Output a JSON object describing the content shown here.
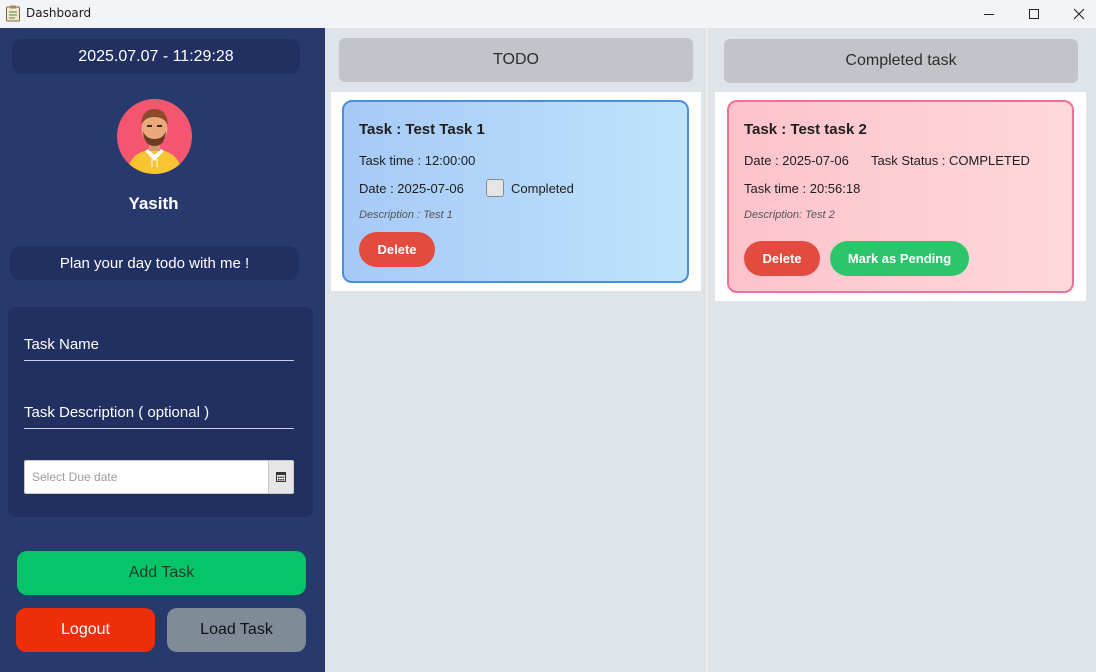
{
  "window": {
    "title": "Dashboard"
  },
  "sidebar": {
    "datetime": "2025.07.07 - 11:29:28",
    "user_name": "Yasith",
    "motto": "Plan your day todo with me !",
    "form": {
      "task_name_placeholder": "Task Name",
      "task_description_placeholder": "Task Description ( optional )",
      "due_date_placeholder": "Select Due date"
    },
    "buttons": {
      "add_task": "Add Task",
      "logout": "Logout",
      "load_task": "Load Task"
    }
  },
  "todo_column": {
    "header": "TODO",
    "tasks": [
      {
        "title": "Task : Test Task 1",
        "time": "Task time : 12:00:00",
        "date": "Date : 2025-07-06",
        "completed_label": "Completed",
        "completed": false,
        "description": "Description : Test 1",
        "delete_label": "Delete"
      }
    ]
  },
  "completed_column": {
    "header": "Completed task",
    "tasks": [
      {
        "title": "Task : Test task 2",
        "date": "Date : 2025-07-06",
        "status": "Task Status : COMPLETED",
        "time": "Task time : 20:56:18",
        "description": "Description: Test 2",
        "delete_label": "Delete",
        "pending_label": "Mark as Pending"
      }
    ]
  },
  "colors": {
    "sidebar_bg": "#28396e",
    "panel_bg": "#213061",
    "add_button": "#06c46a",
    "logout_button": "#ec2f0a",
    "load_button": "#7f8c98",
    "delete_button": "#e44b3f",
    "pending_button": "#2bc66b",
    "todo_card_border": "#4a8ee0",
    "done_card_border": "#f36f95"
  },
  "icons": {
    "app": "clipboard-icon",
    "date_picker": "calendar-icon",
    "avatar": "user-avatar"
  }
}
